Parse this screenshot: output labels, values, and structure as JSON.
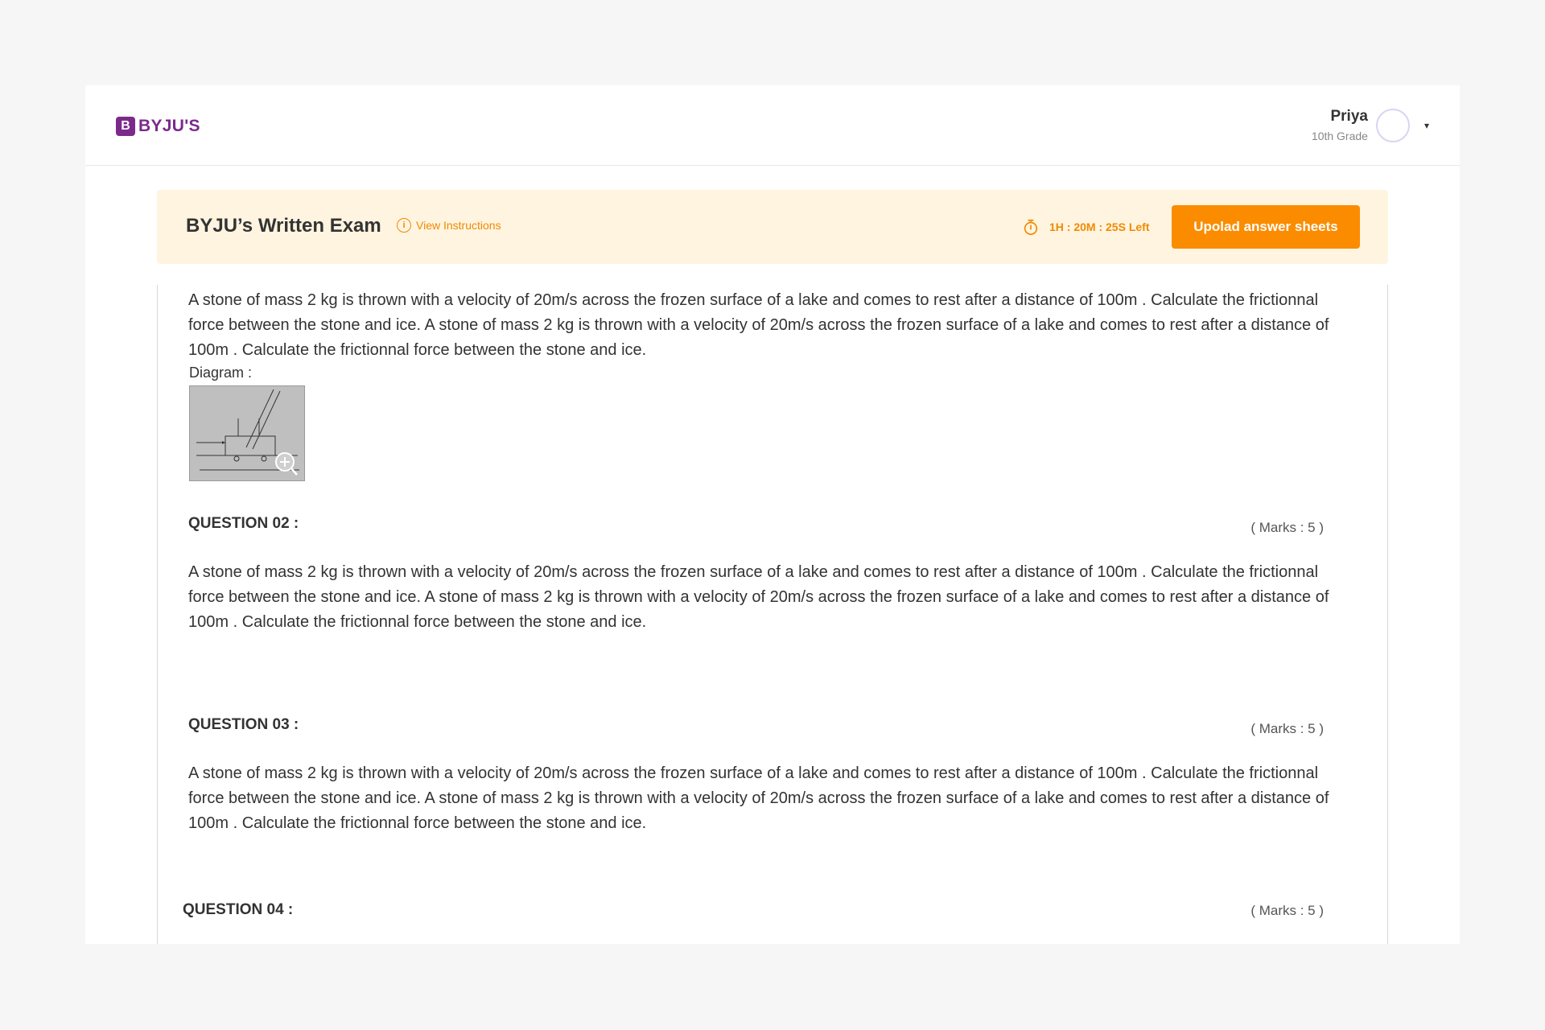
{
  "header": {
    "logo_text": "BYJU'S",
    "logo_mark": "B",
    "user_name": "Priya",
    "user_grade": "10th Grade",
    "caret": "▾"
  },
  "exam": {
    "title": "BYJU’s Written Exam",
    "view_instructions": "View Instructions",
    "info_glyph": "i",
    "timer": "1H : 20M : 25S Left",
    "upload_label": "Upolad answer sheets",
    "accent_color": "#fb8c00"
  },
  "questions": {
    "q1_text": "A stone of mass 2 kg is thrown with a velocity of 20m/s  across the frozen surface of a lake and comes to rest after a distance of 100m . Calculate the frictionnal force between the stone and ice. A stone of mass 2 kg is thrown with a velocity of 20m/s  across the frozen surface of a lake and comes to rest after a distance of 100m . Calculate the frictionnal force between the stone and ice.",
    "diagram_label": "Diagram :",
    "q2_head": "QUESTION 02 :",
    "q2_marks": "( Marks : 5 )",
    "q2_text": "A stone of mass 2 kg is thrown with a velocity of 20m/s  across the frozen surface of a lake and comes to rest after a distance of 100m . Calculate the frictionnal force between the stone and ice. A stone of mass 2 kg is thrown with a velocity of 20m/s  across the frozen surface of a lake and comes to rest after a distance of 100m . Calculate the frictionnal force between the stone and ice.",
    "q3_head": "QUESTION 03 :",
    "q3_marks": "( Marks : 5 )",
    "q3_text": "A stone of mass 2 kg is thrown with a velocity of 20m/s  across the frozen surface of a lake and comes to rest after a distance of 100m . Calculate the frictionnal force between the stone and ice. A stone of mass 2 kg is thrown with a velocity of 20m/s  across the frozen surface of a lake and comes to rest after a distance of 100m . Calculate the frictionnal force between the stone and ice.",
    "q4_head": "QUESTION 04 :",
    "q4_marks": "( Marks : 5 )"
  }
}
